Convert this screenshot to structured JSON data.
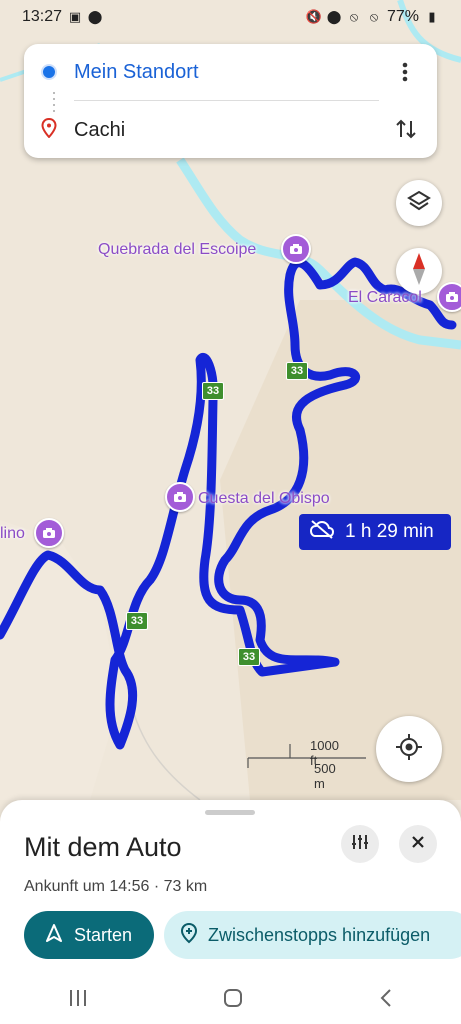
{
  "status": {
    "time": "13:27",
    "battery": "77%"
  },
  "route": {
    "origin": "Mein Standort",
    "destination": "Cachi"
  },
  "map": {
    "pois": [
      {
        "name": "Quebrada del Escoipe"
      },
      {
        "name": "El Caracol"
      },
      {
        "name": "Cuesta del Obispo"
      },
      {
        "name": "lino"
      }
    ],
    "road_shields": [
      "33",
      "33",
      "33",
      "33"
    ],
    "duration": "1 h 29 min",
    "scale": {
      "imperial": "1000 ft",
      "metric": "500 m"
    },
    "colors": {
      "route": "#1525d6",
      "river": "#aeeaf2",
      "land": "#efe7da"
    }
  },
  "sheet": {
    "title": "Mit dem Auto",
    "arrival": "Ankunft um 14:56 · 73 km",
    "start_label": "Starten",
    "stops_label": "Zwischenstopps hinzufügen"
  },
  "icons": [
    "image-icon",
    "location-icon",
    "mute-icon",
    "block-icon",
    "battery-icon",
    "more-vert-icon",
    "swap-icon",
    "layers-icon",
    "compass-icon",
    "camera-icon",
    "cloud-off-icon",
    "my-location-icon",
    "tune-icon",
    "close-icon",
    "navigation-icon",
    "add-stop-icon",
    "recents-icon",
    "home-icon",
    "back-icon"
  ]
}
